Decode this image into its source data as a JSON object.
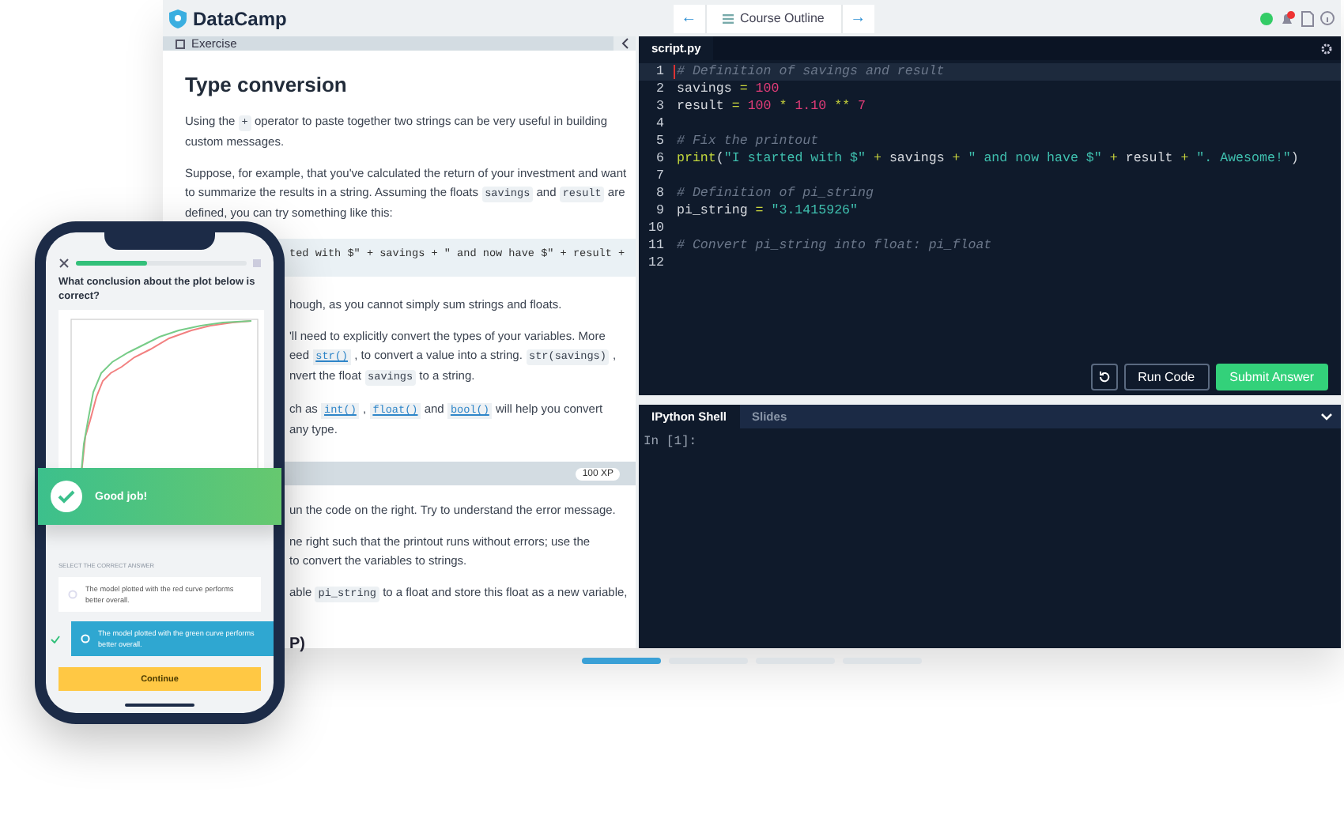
{
  "topbar": {
    "logo": "DataCamp",
    "nav_prev": "←",
    "nav_title": "Course Outline",
    "nav_next": "→"
  },
  "exercise": {
    "tab": "Exercise",
    "title": "Type conversion",
    "blocks": [
      {
        "kind": "paragraph",
        "clipped": false,
        "lines": [
          [
            {
              "kind": "text",
              "text": "Using the "
            },
            {
              "kind": "code",
              "text": "+"
            },
            {
              "kind": "text",
              "text": " operator to paste together two strings can be very useful in building custom messages."
            }
          ]
        ]
      },
      {
        "kind": "paragraph",
        "clipped": false,
        "lines": [
          [
            {
              "kind": "text",
              "text": "Suppose, for example, that you've calculated the return of your investment and want to summarize the results in a string. Assuming the floats "
            },
            {
              "kind": "code",
              "text": "savings"
            },
            {
              "kind": "text",
              "text": " and "
            },
            {
              "kind": "code",
              "text": "result"
            },
            {
              "kind": "text",
              "text": " are defined, you can try something like this:"
            }
          ]
        ]
      },
      {
        "kind": "codeblock",
        "clipped": true,
        "lines": [
          [
            {
              "kind": "text",
              "text": "ted with $\" + savings + \" and now have $\" + result +"
            }
          ]
        ]
      },
      {
        "kind": "paragraph",
        "clipped": true,
        "lines": [
          [
            {
              "kind": "text",
              "text": "hough, as you cannot simply sum strings and floats."
            }
          ]
        ]
      },
      {
        "kind": "paragraph",
        "clipped": true,
        "lines": [
          [
            {
              "kind": "text",
              "text": "'ll need to explicitly convert the types of your variables. More"
            }
          ],
          [
            {
              "kind": "text",
              "text": "eed "
            },
            {
              "kind": "link",
              "text": "str()"
            },
            {
              "kind": "text",
              "text": " , to convert a value into a string. "
            },
            {
              "kind": "code",
              "text": "str(savings)"
            },
            {
              "kind": "text",
              "text": " ,"
            }
          ],
          [
            {
              "kind": "text",
              "text": "nvert the float "
            },
            {
              "kind": "code",
              "text": "savings"
            },
            {
              "kind": "text",
              "text": " to a string."
            }
          ]
        ]
      },
      {
        "kind": "paragraph",
        "clipped": true,
        "lines": [
          [
            {
              "kind": "text",
              "text": "ch as "
            },
            {
              "kind": "link",
              "text": "int()"
            },
            {
              "kind": "text",
              "text": " , "
            },
            {
              "kind": "link",
              "text": "float()"
            },
            {
              "kind": "text",
              "text": " and "
            },
            {
              "kind": "link",
              "text": "bool()"
            },
            {
              "kind": "text",
              "text": " will help you convert"
            }
          ],
          [
            {
              "kind": "text",
              "text": "any type."
            }
          ]
        ]
      }
    ],
    "xp": "100 XP",
    "instructions": [
      {
        "kind": "paragraph",
        "clipped": true,
        "lines": [
          [
            {
              "kind": "text",
              "text": "un the code on the right. Try to understand the error message."
            }
          ]
        ]
      },
      {
        "kind": "paragraph",
        "clipped": true,
        "lines": [
          [
            {
              "kind": "text",
              "text": "ne right such that the printout runs without errors; use the"
            }
          ],
          [
            {
              "kind": "text",
              "text": "to convert the variables to strings."
            }
          ]
        ]
      },
      {
        "kind": "paragraph",
        "clipped": true,
        "lines": [
          [
            {
              "kind": "text",
              "text": "able "
            },
            {
              "kind": "code",
              "text": "pi_string"
            },
            {
              "kind": "text",
              "text": " to a float and store this float as a new variable,"
            }
          ]
        ]
      },
      {
        "kind": "heading",
        "clipped": true,
        "lines": [
          [
            {
              "kind": "text",
              "text": "P)"
            }
          ]
        ]
      }
    ]
  },
  "editor": {
    "tab": "script.py",
    "lines": [
      {
        "number": "1",
        "active": true,
        "tokens": [
          {
            "kind": "comment",
            "text": "# Definition of savings and result"
          }
        ]
      },
      {
        "number": "2",
        "active": false,
        "tokens": [
          {
            "kind": "name",
            "text": "savings"
          },
          {
            "kind": "op",
            "text": " = "
          },
          {
            "kind": "num",
            "text": "100"
          }
        ]
      },
      {
        "number": "3",
        "active": false,
        "tokens": [
          {
            "kind": "name",
            "text": "result"
          },
          {
            "kind": "op",
            "text": " = "
          },
          {
            "kind": "num",
            "text": "100"
          },
          {
            "kind": "op",
            "text": " * "
          },
          {
            "kind": "num",
            "text": "1.10"
          },
          {
            "kind": "op",
            "text": " ** "
          },
          {
            "kind": "num",
            "text": "7"
          }
        ]
      },
      {
        "number": "4",
        "active": false
      },
      {
        "number": "5",
        "active": false,
        "tokens": [
          {
            "kind": "comment",
            "text": "# Fix the printout"
          }
        ]
      },
      {
        "number": "6",
        "active": false,
        "tokens": [
          {
            "kind": "func",
            "text": "print"
          },
          {
            "kind": "name",
            "text": "("
          },
          {
            "kind": "str",
            "text": "\"I started with $\""
          },
          {
            "kind": "op",
            "text": " + "
          },
          {
            "kind": "name",
            "text": "savings"
          },
          {
            "kind": "op",
            "text": " + "
          },
          {
            "kind": "str",
            "text": "\" and now have $\""
          },
          {
            "kind": "op",
            "text": " + "
          },
          {
            "kind": "name",
            "text": "result"
          },
          {
            "kind": "op",
            "text": " + "
          },
          {
            "kind": "str",
            "text": "\". Awesome!\""
          },
          {
            "kind": "name",
            "text": ")"
          }
        ]
      },
      {
        "number": "7",
        "active": false
      },
      {
        "number": "8",
        "active": false,
        "tokens": [
          {
            "kind": "comment",
            "text": "# Definition of pi_string"
          }
        ]
      },
      {
        "number": "9",
        "active": false,
        "tokens": [
          {
            "kind": "name",
            "text": "pi_string"
          },
          {
            "kind": "op",
            "text": " = "
          },
          {
            "kind": "str",
            "text": "\"3.1415926\""
          }
        ]
      },
      {
        "number": "10",
        "active": false
      },
      {
        "number": "11",
        "active": false,
        "tokens": [
          {
            "kind": "comment",
            "text": "# Convert pi_string into float: pi_float"
          }
        ]
      },
      {
        "number": "12",
        "active": false
      }
    ],
    "run": "Run Code",
    "submit": "Submit Answer"
  },
  "console": {
    "tabs": [
      {
        "label": "IPython Shell",
        "selected": true
      },
      {
        "label": "Slides",
        "selected": false
      }
    ],
    "prompt": "In [1]:"
  },
  "pager": [
    {
      "selected": true
    },
    {
      "selected": false
    },
    {
      "selected": false
    },
    {
      "selected": false
    }
  ],
  "phone": {
    "progress": {
      "level": 0.42
    },
    "question": "What conclusion about the plot below is correct?",
    "banner": "Good job!",
    "select_label": "SELECT THE CORRECT ANSWER",
    "options": [
      {
        "text": "The model plotted with the red curve performs better overall.",
        "selected": false,
        "correct": false
      },
      {
        "text": "The model plotted with the green curve performs better overall.",
        "selected": true,
        "correct": true
      }
    ],
    "continue": "Continue"
  }
}
